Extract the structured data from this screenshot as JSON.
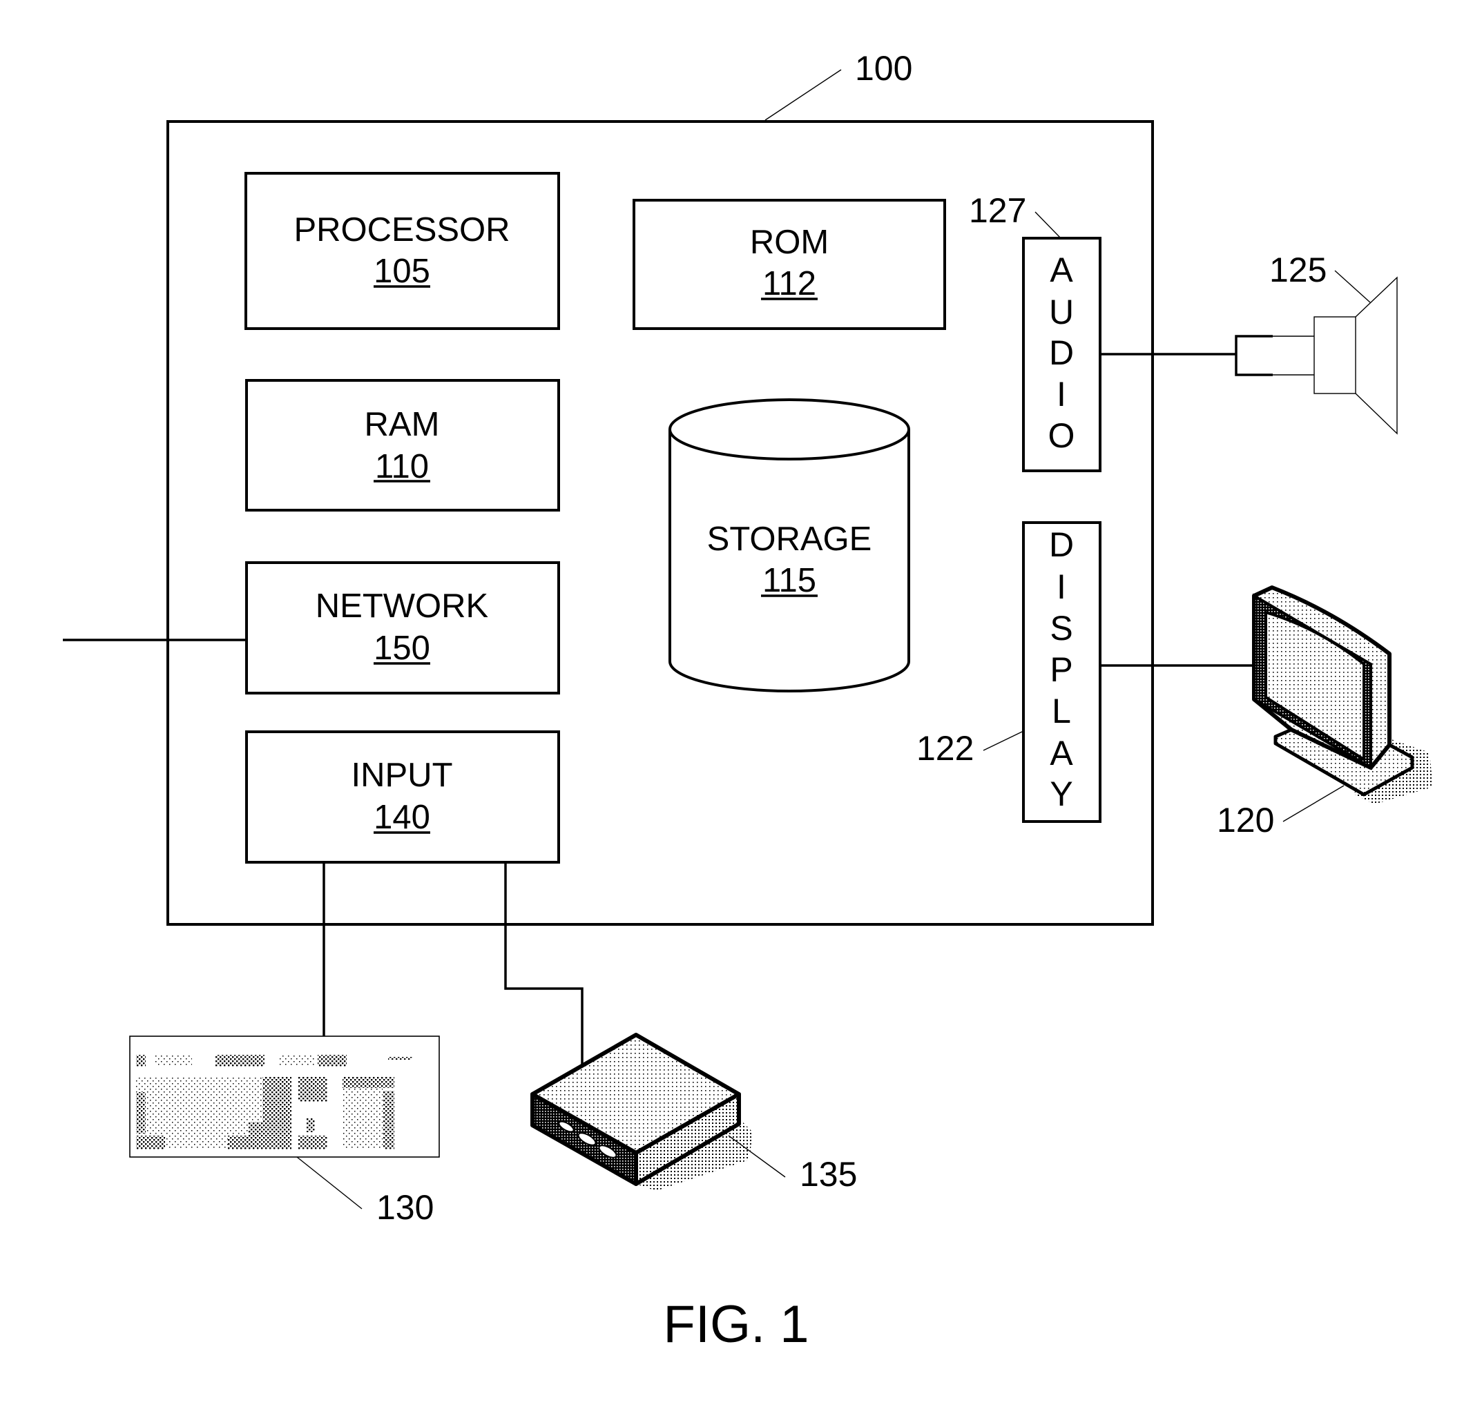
{
  "figure": {
    "caption": "FIG. 1",
    "system": {
      "ref": "100"
    },
    "components": {
      "processor": {
        "title": "PROCESSOR",
        "ref": "105"
      },
      "ram": {
        "title": "RAM",
        "ref": "110"
      },
      "network": {
        "title": "NETWORK",
        "ref": "150"
      },
      "input": {
        "title": "INPUT",
        "ref": "140"
      },
      "rom": {
        "title": "ROM",
        "ref": "112"
      },
      "storage": {
        "title": "STORAGE",
        "ref": "115"
      },
      "audio": {
        "letters": [
          "A",
          "U",
          "D",
          "I",
          "O"
        ],
        "ref": "127"
      },
      "display": {
        "letters": [
          "D",
          "I",
          "S",
          "P",
          "L",
          "A",
          "Y"
        ],
        "ref": "122"
      }
    },
    "peripherals": {
      "speaker": {
        "ref": "125"
      },
      "monitor": {
        "ref": "120"
      },
      "keyboard": {
        "ref": "130"
      },
      "device": {
        "ref": "135"
      }
    }
  }
}
